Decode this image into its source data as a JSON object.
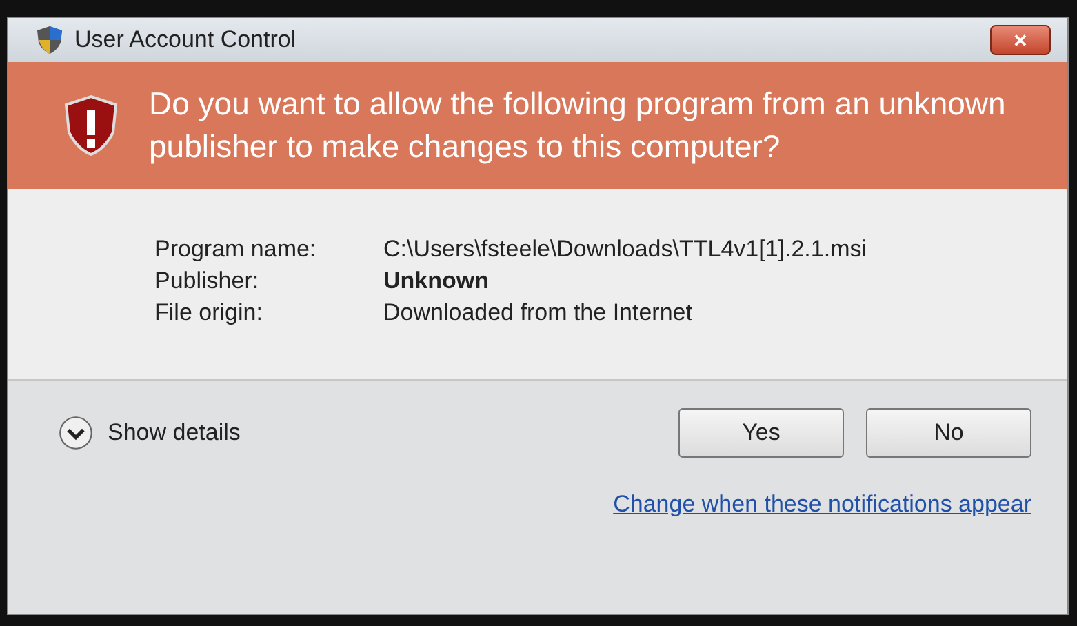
{
  "window": {
    "title": "User Account Control",
    "close": "✕"
  },
  "banner": {
    "question": "Do you want to allow the following program from an unknown publisher to make changes to this computer?"
  },
  "details": [
    {
      "label": "Program name:",
      "value": "C:\\Users\\fsteele\\Downloads\\TTL4v1[1].2.1.msi",
      "bold": false
    },
    {
      "label": "Publisher:",
      "value": "Unknown",
      "bold": true
    },
    {
      "label": "File origin:",
      "value": "Downloaded from the Internet",
      "bold": false
    }
  ],
  "show_details": {
    "label": "Show details",
    "expanded": false
  },
  "buttons": [
    "Yes",
    "No"
  ],
  "link": "Change when these notifications appear"
}
